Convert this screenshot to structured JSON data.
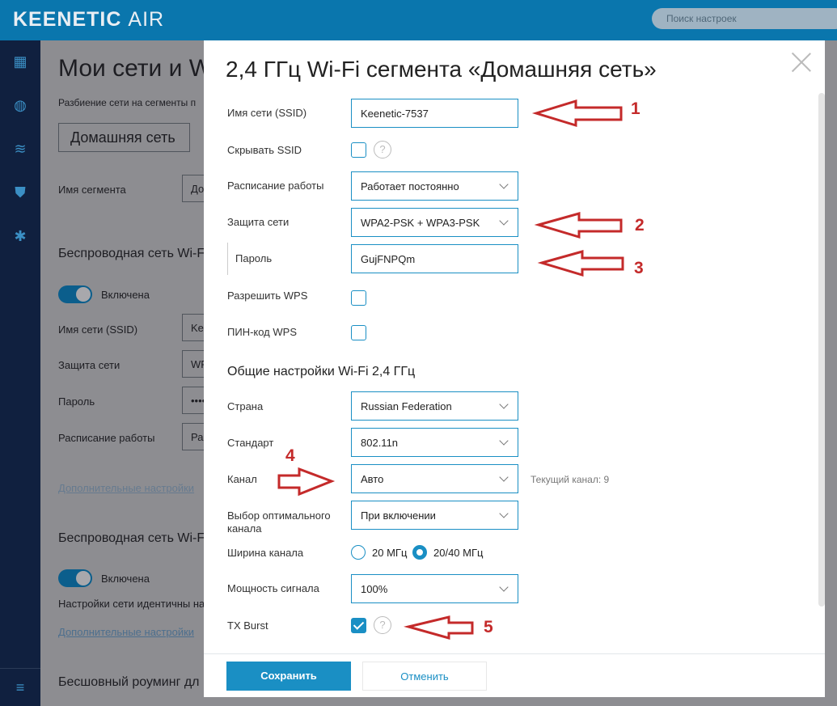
{
  "header": {
    "logo": "KEENETIC",
    "logo_suffix": "AIR",
    "search_placeholder": "Поиск настроек"
  },
  "sidebar": {
    "icons": [
      "dashboard-icon",
      "globe-icon",
      "wifi-icon",
      "shield-icon",
      "gear-icon",
      "menu-icon"
    ]
  },
  "background": {
    "title": "Мои сети и Wi-Fi",
    "subtitle": "Разбиение сети на сегменты п",
    "tab": "Домашняя сеть",
    "segment_label": "Имя сегмента",
    "segment_value": "До",
    "wifi24_title": "Беспроводная сеть Wi-Fi",
    "enabled": "Включена",
    "ssid_label": "Имя сети (SSID)",
    "ssid_value": "Ke",
    "security_label": "Защита сети",
    "security_value": "WP",
    "password_label": "Пароль",
    "password_value": "••••",
    "schedule_label": "Расписание работы",
    "schedule_value": "Ра",
    "advanced_link": "Дополнительные настройки",
    "wifi5_title": "Беспроводная сеть Wi-Fi",
    "enabled2": "Включена",
    "identical_note": "Настройки сети идентичны на",
    "advanced_link2": "Дополнительные настройки",
    "roaming_title": "Бесшовный роуминг дл"
  },
  "modal": {
    "title": "2,4 ГГц Wi-Fi сегмента «Домашняя сеть»",
    "ssid_label": "Имя сети (SSID)",
    "ssid_value": "Keenetic-7537",
    "hide_ssid_label": "Скрывать SSID",
    "hide_ssid_checked": false,
    "schedule_label": "Расписание работы",
    "schedule_value": "Работает постоянно",
    "security_label": "Защита сети",
    "security_value": "WPA2-PSK + WPA3-PSK",
    "password_label": "Пароль",
    "password_value": "GujFNPQm",
    "wps_label": "Разрешить WPS",
    "wps_checked": false,
    "wps_pin_label": "ПИН-код WPS",
    "wps_pin_checked": false,
    "general_heading": "Общие настройки Wi-Fi 2,4 ГГц",
    "country_label": "Страна",
    "country_value": "Russian Federation",
    "standard_label": "Стандарт",
    "standard_value": "802.11n",
    "channel_label": "Канал",
    "channel_value": "Авто",
    "current_channel": "Текущий канал: 9",
    "optimal_label": "Выбор оптимального канала",
    "optimal_value": "При включении",
    "width_label": "Ширина канала",
    "width_options": [
      "20 МГц",
      "20/40 МГц"
    ],
    "width_selected": "20/40 МГц",
    "power_label": "Мощность сигнала",
    "power_value": "100%",
    "txburst_label": "TX Burst",
    "txburst_checked": true,
    "help": "?",
    "save": "Сохранить",
    "cancel": "Отменить"
  },
  "annotations": [
    "1",
    "2",
    "3",
    "4",
    "5"
  ],
  "colors": {
    "accent": "#1a8fc4",
    "header": "#0a76ad",
    "sidebar": "#10203f",
    "annotation": "#c42a2a"
  }
}
